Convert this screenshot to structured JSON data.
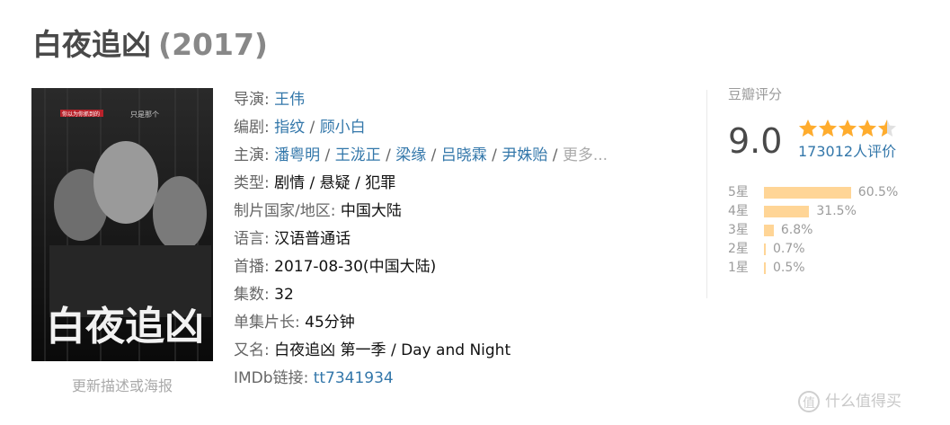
{
  "title": {
    "name": "白夜追凶",
    "year": "(2017)"
  },
  "poster": {
    "art_title": "白夜追凶",
    "tagline_left": "你以为你抓到的",
    "tagline_right": "只是那个",
    "link_label": "更新描述或海报"
  },
  "info": {
    "director_label": "导演",
    "director": "王伟",
    "writer_label": "编剧",
    "writers": [
      "指纹",
      "顾小白"
    ],
    "cast_label": "主演",
    "cast": [
      "潘粤明",
      "王泷正",
      "梁缘",
      "吕晓霖",
      "尹姝贻"
    ],
    "cast_more": "更多...",
    "genre_label": "类型",
    "genres": "剧情 / 悬疑 / 犯罪",
    "country_label": "制片国家/地区",
    "country": "中国大陆",
    "language_label": "语言",
    "language": "汉语普通话",
    "premiere_label": "首播",
    "premiere": "2017-08-30(中国大陆)",
    "episodes_label": "集数",
    "episodes": "32",
    "runtime_label": "单集片长",
    "runtime": "45分钟",
    "aka_label": "又名",
    "aka": "白夜追凶 第一季 / Day and Night",
    "imdb_label": "IMDb链接",
    "imdb": "tt7341934"
  },
  "rating": {
    "title": "豆瓣评分",
    "score": "9.0",
    "stars_value": 4.5,
    "votes": "173012人评价",
    "breakdown": [
      {
        "label": "5星",
        "pct_text": "60.5%",
        "pct": 60.5
      },
      {
        "label": "4星",
        "pct_text": "31.5%",
        "pct": 31.5
      },
      {
        "label": "3星",
        "pct_text": "6.8%",
        "pct": 6.8
      },
      {
        "label": "2星",
        "pct_text": "0.7%",
        "pct": 0.7
      },
      {
        "label": "1星",
        "pct_text": "0.5%",
        "pct": 0.5
      }
    ]
  },
  "watermark": {
    "text": "什么值得买",
    "icon": "值"
  },
  "colors": {
    "link": "#3377aa",
    "star": "#ffac2d",
    "bar": "#ffd596"
  }
}
